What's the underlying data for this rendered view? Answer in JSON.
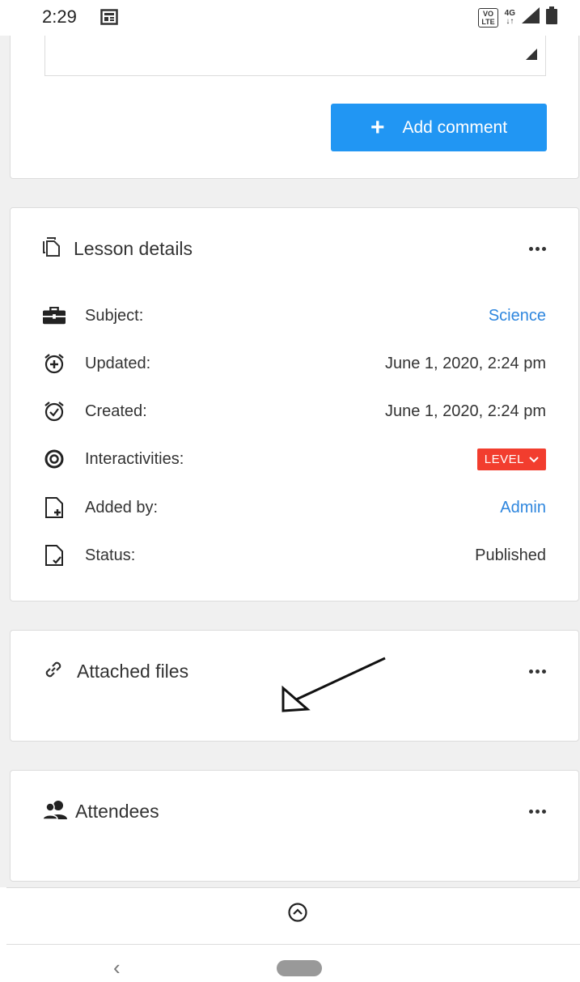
{
  "status_bar": {
    "time": "2:29",
    "volte_top": "VO",
    "volte_bottom": "LTE",
    "network_type": "4G",
    "network_arrows": "↓↑"
  },
  "comment": {
    "add_button_label": "Add comment"
  },
  "lesson_details": {
    "title": "Lesson details",
    "rows": [
      {
        "label": "Subject:",
        "value": "Science",
        "icon": "briefcase-icon"
      },
      {
        "label": "Updated:",
        "value": "June 1, 2020, 2:24 pm",
        "icon": "alarm-plus-icon"
      },
      {
        "label": "Created:",
        "value": "June 1, 2020, 2:24 pm",
        "icon": "alarm-check-icon"
      },
      {
        "label": "Interactivities:",
        "value": "LEVEL",
        "icon": "target-icon"
      },
      {
        "label": "Added by:",
        "value": "Admin",
        "icon": "file-plus-icon"
      },
      {
        "label": "Status:",
        "value": "Published",
        "icon": "file-check-icon"
      }
    ]
  },
  "attached_files": {
    "title": "Attached files"
  },
  "attendees": {
    "title": "Attendees"
  },
  "colors": {
    "accent": "#2196f3",
    "link": "#2e86de",
    "badge": "#f23d2e"
  }
}
